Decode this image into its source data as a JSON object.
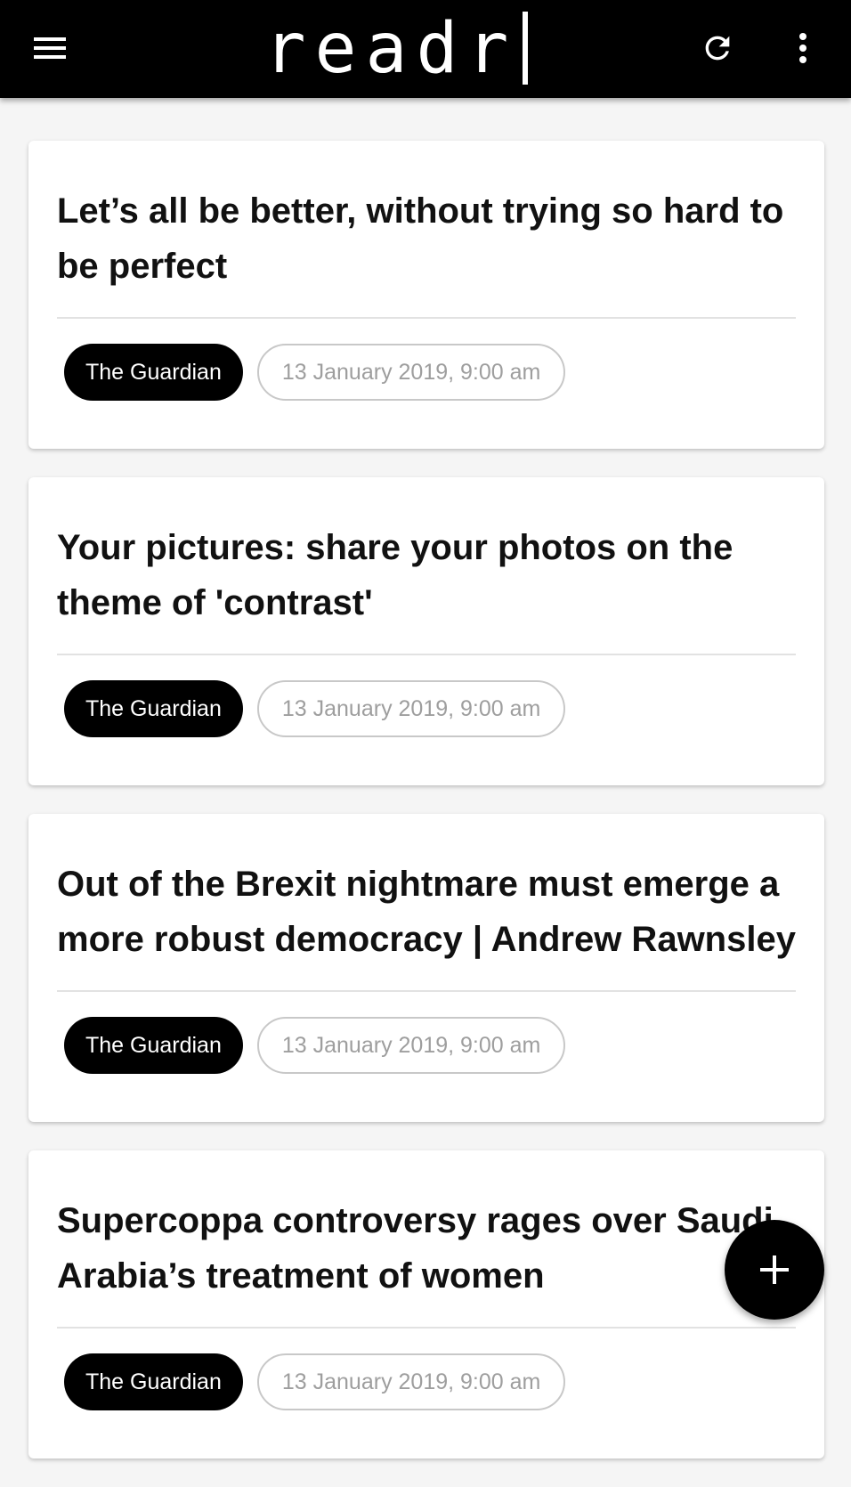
{
  "app": {
    "title": "readr",
    "icons": {
      "menu": "hamburger-menu-icon",
      "refresh": "refresh-icon",
      "more": "more-vert-icon",
      "add": "plus-icon"
    },
    "colors": {
      "appbar": "#000000",
      "background": "#f5f5f5",
      "card": "#ffffff",
      "chip_source": "#000000",
      "chip_date_border": "#c8c8c8",
      "chip_date_text": "#9e9e9e"
    }
  },
  "articles": [
    {
      "title": "Let’s all be better, without trying so hard to be perfect",
      "source": "The Guardian",
      "date": "13 January 2019, 9:00 am"
    },
    {
      "title": "Your pictures: share your photos on the theme of 'contrast'",
      "source": "The Guardian",
      "date": "13 January 2019, 9:00 am"
    },
    {
      "title": "Out of the Brexit nightmare must emerge a more robust democracy | Andrew Rawnsley",
      "source": "The Guardian",
      "date": "13 January 2019, 9:00 am"
    },
    {
      "title": "Supercoppa controversy rages over Saudi Arabia’s treatment of women",
      "source": "The Guardian",
      "date": "13 January 2019, 9:00 am"
    }
  ]
}
